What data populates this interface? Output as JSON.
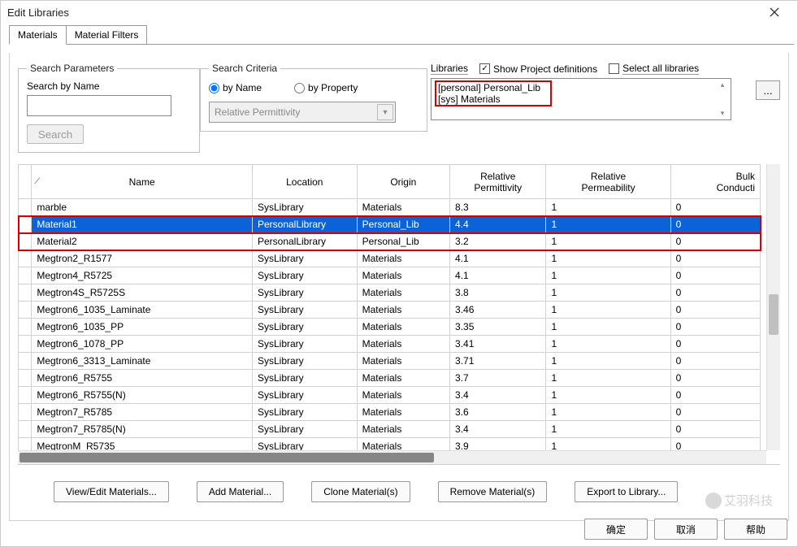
{
  "title": "Edit Libraries",
  "tabs": {
    "materials": "Materials",
    "filters": "Material Filters"
  },
  "searchParams": {
    "legend": "Search Parameters",
    "label": "Search by Name",
    "button": "Search"
  },
  "searchCriteria": {
    "legend": "Search Criteria",
    "byName": "by Name",
    "byProperty": "by Property",
    "combo": "Relative Permittivity"
  },
  "libraries": {
    "label": "Libraries",
    "showProject": "Show Project definitions",
    "selectAll": "Select all libraries",
    "items": [
      "[personal] Personal_Lib",
      "[sys] Materials"
    ],
    "browse": "..."
  },
  "columns": {
    "name": "Name",
    "location": "Location",
    "origin": "Origin",
    "relperm": "Relative Permittivity",
    "relpermb": "Relative Permeability",
    "bulk": "Bulk Conducti"
  },
  "rows": [
    {
      "name": "marble",
      "location": "SysLibrary",
      "origin": "Materials",
      "rp": "8.3",
      "rpb": "1",
      "bulk": "0",
      "sel": false,
      "hl": false
    },
    {
      "name": "Material1",
      "location": "PersonalLibrary",
      "origin": "Personal_Lib",
      "rp": "4.4",
      "rpb": "1",
      "bulk": "0",
      "sel": true,
      "hl": true
    },
    {
      "name": "Material2",
      "location": "PersonalLibrary",
      "origin": "Personal_Lib",
      "rp": "3.2",
      "rpb": "1",
      "bulk": "0",
      "sel": false,
      "hl": true
    },
    {
      "name": "Megtron2_R1577",
      "location": "SysLibrary",
      "origin": "Materials",
      "rp": "4.1",
      "rpb": "1",
      "bulk": "0",
      "sel": false,
      "hl": false
    },
    {
      "name": "Megtron4_R5725",
      "location": "SysLibrary",
      "origin": "Materials",
      "rp": "4.1",
      "rpb": "1",
      "bulk": "0",
      "sel": false,
      "hl": false
    },
    {
      "name": "Megtron4S_R5725S",
      "location": "SysLibrary",
      "origin": "Materials",
      "rp": "3.8",
      "rpb": "1",
      "bulk": "0",
      "sel": false,
      "hl": false
    },
    {
      "name": "Megtron6_1035_Laminate",
      "location": "SysLibrary",
      "origin": "Materials",
      "rp": "3.46",
      "rpb": "1",
      "bulk": "0",
      "sel": false,
      "hl": false
    },
    {
      "name": "Megtron6_1035_PP",
      "location": "SysLibrary",
      "origin": "Materials",
      "rp": "3.35",
      "rpb": "1",
      "bulk": "0",
      "sel": false,
      "hl": false
    },
    {
      "name": "Megtron6_1078_PP",
      "location": "SysLibrary",
      "origin": "Materials",
      "rp": "3.41",
      "rpb": "1",
      "bulk": "0",
      "sel": false,
      "hl": false
    },
    {
      "name": "Megtron6_3313_Laminate",
      "location": "SysLibrary",
      "origin": "Materials",
      "rp": "3.71",
      "rpb": "1",
      "bulk": "0",
      "sel": false,
      "hl": false
    },
    {
      "name": "Megtron6_R5755",
      "location": "SysLibrary",
      "origin": "Materials",
      "rp": "3.7",
      "rpb": "1",
      "bulk": "0",
      "sel": false,
      "hl": false
    },
    {
      "name": "Megtron6_R5755(N)",
      "location": "SysLibrary",
      "origin": "Materials",
      "rp": "3.4",
      "rpb": "1",
      "bulk": "0",
      "sel": false,
      "hl": false
    },
    {
      "name": "Megtron7_R5785",
      "location": "SysLibrary",
      "origin": "Materials",
      "rp": "3.6",
      "rpb": "1",
      "bulk": "0",
      "sel": false,
      "hl": false
    },
    {
      "name": "Megtron7_R5785(N)",
      "location": "SysLibrary",
      "origin": "Materials",
      "rp": "3.4",
      "rpb": "1",
      "bulk": "0",
      "sel": false,
      "hl": false
    },
    {
      "name": "MegtronM_R5735",
      "location": "SysLibrary",
      "origin": "Materials",
      "rp": "3.9",
      "rpb": "1",
      "bulk": "0",
      "sel": false,
      "hl": false
    }
  ],
  "actions": {
    "viewEdit": "View/Edit Materials...",
    "add": "Add Material...",
    "clone": "Clone Material(s)",
    "remove": "Remove Material(s)",
    "export": "Export to Library..."
  },
  "footer": {
    "ok": "确定",
    "cancel": "取消",
    "help": "帮助"
  },
  "watermark": "艾羽科技"
}
